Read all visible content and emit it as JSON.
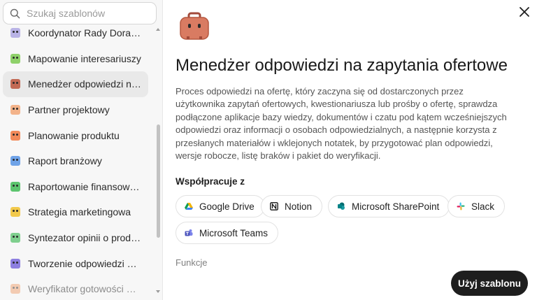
{
  "search": {
    "placeholder": "Szukaj szablonów",
    "icon": "search-icon"
  },
  "sidebar": {
    "items": [
      {
        "label": "Koordynator Rady Doradcz...",
        "color": "#b9b3e6",
        "selected": false,
        "faded": false
      },
      {
        "label": "Mapowanie interesariuszy",
        "color": "#8fd16a",
        "selected": false,
        "faded": false
      },
      {
        "label": "Menedżer odpowiedzi na z...",
        "color": "#c26a55",
        "selected": true,
        "faded": false
      },
      {
        "label": "Partner projektowy",
        "color": "#f3b38a",
        "selected": false,
        "faded": false
      },
      {
        "label": "Planowanie produktu",
        "color": "#f28a5a",
        "selected": false,
        "faded": false
      },
      {
        "label": "Raport branżowy",
        "color": "#6fa3e8",
        "selected": false,
        "faded": false
      },
      {
        "label": "Raportowanie finansowe n...",
        "color": "#5cc46e",
        "selected": false,
        "faded": false
      },
      {
        "label": "Strategia marketingowa",
        "color": "#f2c94c",
        "selected": false,
        "faded": false
      },
      {
        "label": "Syntezator opinii o produk...",
        "color": "#7fcf8e",
        "selected": false,
        "faded": false
      },
      {
        "label": "Tworzenie odpowiedzi do a...",
        "color": "#8d7fe0",
        "selected": false,
        "faded": false
      },
      {
        "label": "Weryfikator gotowości do ...",
        "color": "#f0a070",
        "selected": false,
        "faded": true
      }
    ]
  },
  "main": {
    "hero_icon": "briefcase-icon",
    "title": "Menedżer odpowiedzi na zapytania ofertowe",
    "description": "Proces odpowiedzi na ofertę, który zaczyna się od dostarczonych przez użytkownika zapytań ofertowych, kwestionariusza lub prośby o ofertę, sprawdza podłączone aplikacje bazy wiedzy, dokumentów i czatu pod kątem wcześniejszych odpowiedzi oraz informacji o osobach odpowiedzialnych, a następnie korzysta z przesłanych materiałów i wklejonych notatek, by przygotować plan odpowiedzi, wersje robocze, listę braków i pakiet do weryfikacji.",
    "collab_title": "Współpracuje z",
    "collaborators": [
      {
        "label": "Google Drive",
        "icon": "google-drive-icon"
      },
      {
        "label": "Notion",
        "icon": "notion-icon"
      },
      {
        "label": "Microsoft SharePoint",
        "icon": "sharepoint-icon"
      },
      {
        "label": "Slack",
        "icon": "slack-icon"
      },
      {
        "label": "Microsoft Teams",
        "icon": "teams-icon"
      }
    ],
    "features_title": "Funkcje",
    "use_button": "Użyj szablonu",
    "close_icon": "close-icon"
  },
  "colors": {
    "accent_button": "#1e1e1e",
    "selected_bg": "#e9e9e9",
    "sidebar_bg": "#f7f7f7"
  }
}
